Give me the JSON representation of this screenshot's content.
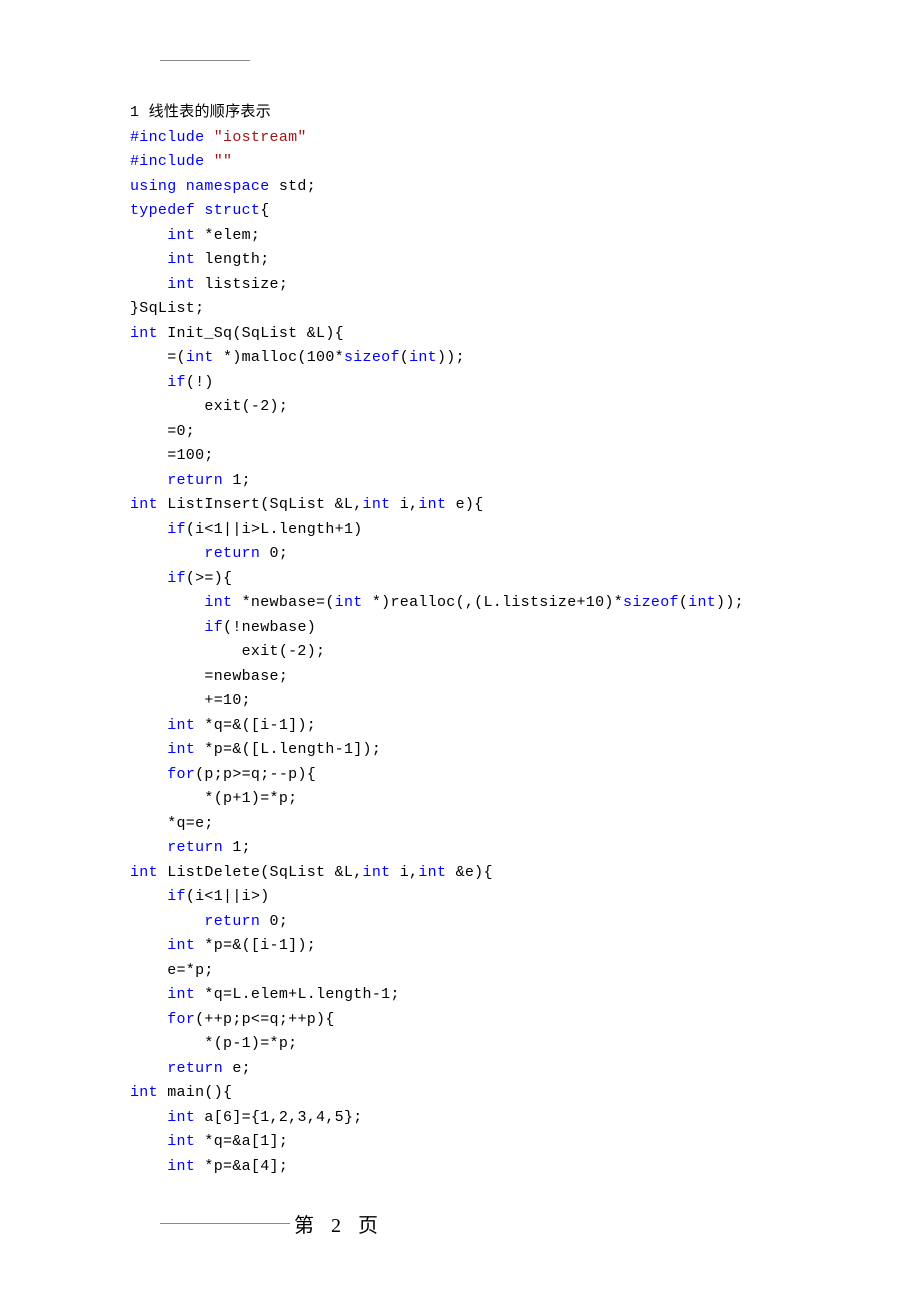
{
  "heading": "1 线性表的顺序表示",
  "code_tokens": [
    [
      [
        "#include ",
        "kw"
      ],
      [
        "\"iostream\"",
        "str"
      ]
    ],
    [
      [
        "#include ",
        "kw"
      ],
      [
        "\"\"",
        "str"
      ]
    ],
    [
      [
        "using namespace",
        "kw"
      ],
      [
        " std;",
        ""
      ]
    ],
    [
      [
        "typedef struct",
        "kw"
      ],
      [
        "{",
        ""
      ]
    ],
    [
      [
        "    ",
        ""
      ],
      [
        "int",
        "kw"
      ],
      [
        " *elem;",
        ""
      ]
    ],
    [
      [
        "    ",
        ""
      ],
      [
        "int",
        "kw"
      ],
      [
        " length;",
        ""
      ]
    ],
    [
      [
        "    ",
        ""
      ],
      [
        "int",
        "kw"
      ],
      [
        " listsize;",
        ""
      ]
    ],
    [
      [
        "}SqList;",
        ""
      ]
    ],
    [
      [
        "int",
        "kw"
      ],
      [
        " Init_Sq(SqList &L){",
        ""
      ]
    ],
    [
      [
        "    =(",
        ""
      ],
      [
        "int",
        "kw"
      ],
      [
        " *)malloc(100*",
        ""
      ],
      [
        "sizeof",
        "kw"
      ],
      [
        "(",
        ""
      ],
      [
        "int",
        "kw"
      ],
      [
        "));",
        ""
      ]
    ],
    [
      [
        "    ",
        ""
      ],
      [
        "if",
        "kw"
      ],
      [
        "(!)",
        ""
      ]
    ],
    [
      [
        "        exit(-2);",
        ""
      ]
    ],
    [
      [
        "    =0;",
        ""
      ]
    ],
    [
      [
        "    =100;",
        ""
      ]
    ],
    [
      [
        "    ",
        ""
      ],
      [
        "return",
        "kw"
      ],
      [
        " 1;",
        ""
      ]
    ],
    [
      [
        "int",
        "kw"
      ],
      [
        " ListInsert(SqList &L,",
        ""
      ],
      [
        "int",
        "kw"
      ],
      [
        " i,",
        ""
      ],
      [
        "int",
        "kw"
      ],
      [
        " e){",
        ""
      ]
    ],
    [
      [
        "    ",
        ""
      ],
      [
        "if",
        "kw"
      ],
      [
        "(i<1||i>L.length+1)",
        ""
      ]
    ],
    [
      [
        "        ",
        ""
      ],
      [
        "return",
        "kw"
      ],
      [
        " 0;",
        ""
      ]
    ],
    [
      [
        "    ",
        ""
      ],
      [
        "if",
        "kw"
      ],
      [
        "(>=){",
        ""
      ]
    ],
    [
      [
        "        ",
        ""
      ],
      [
        "int",
        "kw"
      ],
      [
        " *newbase=(",
        ""
      ],
      [
        "int",
        "kw"
      ],
      [
        " *)realloc(,(L.listsize+10)*",
        ""
      ],
      [
        "sizeof",
        "kw"
      ],
      [
        "(",
        ""
      ],
      [
        "int",
        "kw"
      ],
      [
        "));",
        ""
      ]
    ],
    [
      [
        "        ",
        ""
      ],
      [
        "if",
        "kw"
      ],
      [
        "(!newbase)",
        ""
      ]
    ],
    [
      [
        "            exit(-2);",
        ""
      ]
    ],
    [
      [
        "        =newbase;",
        ""
      ]
    ],
    [
      [
        "        +=10;",
        ""
      ]
    ],
    [
      [
        "    ",
        ""
      ],
      [
        "int",
        "kw"
      ],
      [
        " *q=&([i-1]);",
        ""
      ]
    ],
    [
      [
        "    ",
        ""
      ],
      [
        "int",
        "kw"
      ],
      [
        " *p=&([L.length-1]);",
        ""
      ]
    ],
    [
      [
        "    ",
        ""
      ],
      [
        "for",
        "kw"
      ],
      [
        "(p;p>=q;--p){",
        ""
      ]
    ],
    [
      [
        "        *(p+1)=*p;",
        ""
      ]
    ],
    [
      [
        "    *q=e;",
        ""
      ]
    ],
    [
      [
        "    ",
        ""
      ],
      [
        "return",
        "kw"
      ],
      [
        " 1;",
        ""
      ]
    ],
    [
      [
        "int",
        "kw"
      ],
      [
        " ListDelete(SqList &L,",
        ""
      ],
      [
        "int",
        "kw"
      ],
      [
        " i,",
        ""
      ],
      [
        "int",
        "kw"
      ],
      [
        " &e){",
        ""
      ]
    ],
    [
      [
        "    ",
        ""
      ],
      [
        "if",
        "kw"
      ],
      [
        "(i<1||i>)",
        ""
      ]
    ],
    [
      [
        "        ",
        ""
      ],
      [
        "return",
        "kw"
      ],
      [
        " 0;",
        ""
      ]
    ],
    [
      [
        "    ",
        ""
      ],
      [
        "int",
        "kw"
      ],
      [
        " *p=&([i-1]);",
        ""
      ]
    ],
    [
      [
        "    e=*p;",
        ""
      ]
    ],
    [
      [
        "    ",
        ""
      ],
      [
        "int",
        "kw"
      ],
      [
        " *q=L.elem+L.length-1;",
        ""
      ]
    ],
    [
      [
        "    ",
        ""
      ],
      [
        "for",
        "kw"
      ],
      [
        "(++p;p<=q;++p){",
        ""
      ]
    ],
    [
      [
        "        *(p-1)=*p;",
        ""
      ]
    ],
    [
      [
        "    ",
        ""
      ],
      [
        "return",
        "kw"
      ],
      [
        " e;",
        ""
      ]
    ],
    [
      [
        "int",
        "kw"
      ],
      [
        " main(){",
        ""
      ]
    ],
    [
      [
        "    ",
        ""
      ],
      [
        "int",
        "kw"
      ],
      [
        " a[6]={1,2,3,4,5};",
        ""
      ]
    ],
    [
      [
        "    ",
        ""
      ],
      [
        "int",
        "kw"
      ],
      [
        " *q=&a[1];",
        ""
      ]
    ],
    [
      [
        "    ",
        ""
      ],
      [
        "int",
        "kw"
      ],
      [
        " *p=&a[4];",
        ""
      ]
    ]
  ],
  "footer": "第 2 页"
}
